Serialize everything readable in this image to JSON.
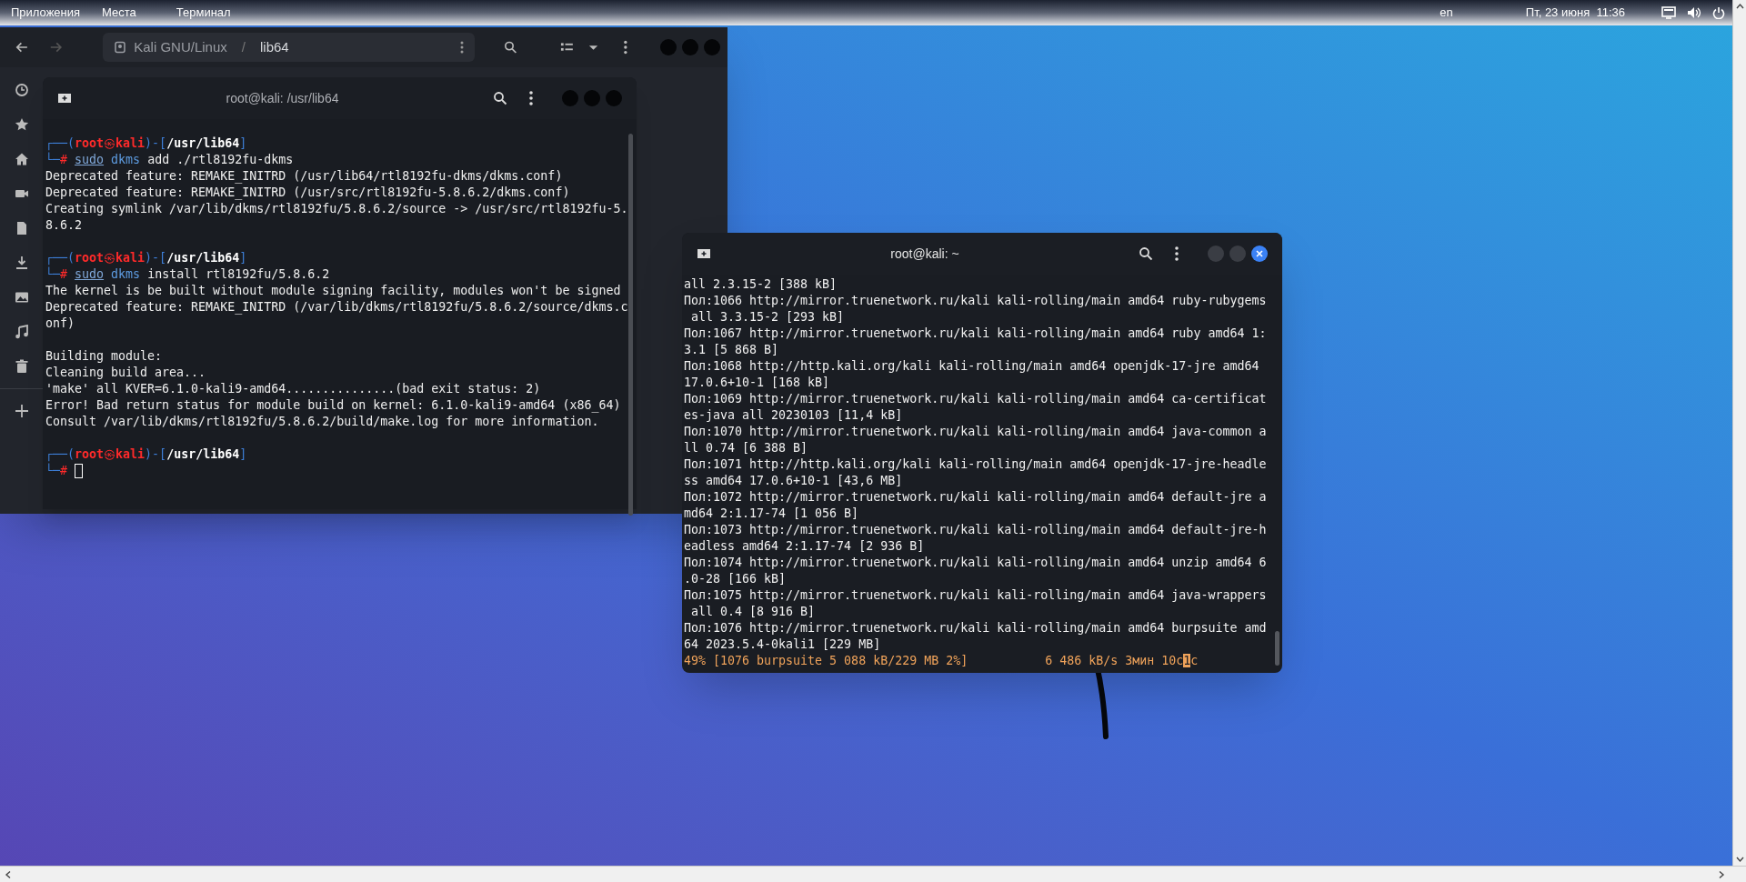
{
  "top_bar": {
    "menus": [
      "Приложения",
      "Места",
      "Терминал"
    ],
    "language": "en",
    "clock": "Пт, 23 июня  11:36"
  },
  "file_manager": {
    "back_disabled": false,
    "forward_disabled": true,
    "path": [
      {
        "label": "Kali GNU/Linux",
        "kind": "drive"
      },
      {
        "label": "/",
        "kind": "separator"
      },
      {
        "label": "lib64",
        "kind": "folder"
      }
    ],
    "sidebar": [
      {
        "kind": "recent"
      },
      {
        "kind": "starred"
      },
      {
        "kind": "home"
      },
      {
        "kind": "videos"
      },
      {
        "kind": "documents"
      },
      {
        "kind": "downloads"
      },
      {
        "kind": "pictures"
      },
      {
        "kind": "music"
      },
      {
        "kind": "trash"
      },
      {
        "kind": "divider"
      },
      {
        "kind": "add"
      }
    ]
  },
  "terminal_left": {
    "title": "root@kali: /usr/lib64",
    "blocks": [
      {
        "kind": "prompt",
        "top": "┌──(",
        "user": "root",
        "at": "㉿",
        "host": "kali",
        "mid": ")-[",
        "path": "/usr/lib64",
        "end": "]",
        "bottom": "└─",
        "sign": "#",
        "sudo": "sudo",
        "program": "dkms",
        "args": "add ./rtl8192fu-dkms"
      },
      {
        "kind": "output",
        "text": "Deprecated feature: REMAKE_INITRD (/usr/lib64/rtl8192fu-dkms/dkms.conf)"
      },
      {
        "kind": "output",
        "text": "Deprecated feature: REMAKE_INITRD (/usr/src/rtl8192fu-5.8.6.2/dkms.conf)"
      },
      {
        "kind": "output",
        "text": "Creating symlink /var/lib/dkms/rtl8192fu/5.8.6.2/source -> /usr/src/rtl8192fu-5."
      },
      {
        "kind": "output",
        "text": "8.6.2"
      },
      {
        "kind": "prompt",
        "top": "┌──(",
        "user": "root",
        "at": "㉿",
        "host": "kali",
        "mid": ")-[",
        "path": "/usr/lib64",
        "end": "]",
        "bottom": "└─",
        "sign": "#",
        "sudo": "sudo",
        "program": "dkms",
        "args": "install rtl8192fu/5.8.6.2"
      },
      {
        "kind": "output",
        "text": "The kernel is be built without module signing facility, modules won't be signed"
      },
      {
        "kind": "output",
        "text": "Deprecated feature: REMAKE_INITRD (/var/lib/dkms/rtl8192fu/5.8.6.2/source/dkms.c"
      },
      {
        "kind": "output",
        "text": "onf)"
      },
      {
        "kind": "blank"
      },
      {
        "kind": "output",
        "text": "Building module:"
      },
      {
        "kind": "output",
        "text": "Cleaning build area..."
      },
      {
        "kind": "output",
        "text": "'make' all KVER=6.1.0-kali9-amd64...............(bad exit status: 2)"
      },
      {
        "kind": "output",
        "text": "Error! Bad return status for module build on kernel: 6.1.0-kali9-amd64 (x86_64)"
      },
      {
        "kind": "output",
        "text": "Consult /var/lib/dkms/rtl8192fu/5.8.6.2/build/make.log for more information."
      },
      {
        "kind": "prompt",
        "top": "┌──(",
        "user": "root",
        "at": "㉿",
        "host": "kali",
        "mid": ")-[",
        "path": "/usr/lib64",
        "end": "]",
        "bottom": "└─",
        "sign": "#",
        "cursor": true
      }
    ]
  },
  "terminal_right": {
    "title": "root@kali: ~",
    "lines": [
      "all 2.3.15-2 [388 kB]",
      "Пол:1066 http://mirror.truenetwork.ru/kali kali-rolling/main amd64 ruby-rubygems",
      " all 3.3.15-2 [293 kB]",
      "Пол:1067 http://mirror.truenetwork.ru/kali kali-rolling/main amd64 ruby amd64 1:",
      "3.1 [5 868 B]",
      "Пол:1068 http://http.kali.org/kali kali-rolling/main amd64 openjdk-17-jre amd64",
      "17.0.6+10-1 [168 kB]",
      "Пол:1069 http://mirror.truenetwork.ru/kali kali-rolling/main amd64 ca-certificat",
      "es-java all 20230103 [11,4 kB]",
      "Пол:1070 http://mirror.truenetwork.ru/kali kali-rolling/main amd64 java-common a",
      "ll 0.74 [6 388 B]",
      "Пол:1071 http://http.kali.org/kali kali-rolling/main amd64 openjdk-17-jre-headle",
      "ss amd64 17.0.6+10-1 [43,6 MB]",
      "Пол:1072 http://mirror.truenetwork.ru/kali kali-rolling/main amd64 default-jre a",
      "md64 2:1.17-74 [1 056 B]",
      "Пол:1073 http://mirror.truenetwork.ru/kali kali-rolling/main amd64 default-jre-h",
      "eadless amd64 2:1.17-74 [2 936 B]",
      "Пол:1074 http://mirror.truenetwork.ru/kali kali-rolling/main amd64 unzip amd64 6",
      ".0-28 [166 kB]",
      "Пол:1075 http://mirror.truenetwork.ru/kali kali-rolling/main amd64 java-wrappers",
      " all 0.4 [8 916 B]",
      "Пол:1076 http://mirror.truenetwork.ru/kali kali-rolling/main amd64 burpsuite amd",
      "64 2023.5.4-0kali1 [229 MB]"
    ],
    "progress": {
      "left": "49% [1076 burpsuite 5 088 kB/229 MB 2%]",
      "right_before": "6 486 kB/s 3мин 10с",
      "cursor_char": "1",
      "right_after": "с"
    }
  }
}
